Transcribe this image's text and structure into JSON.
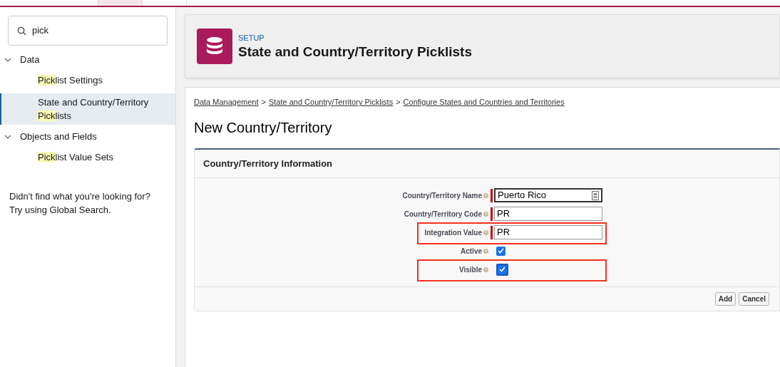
{
  "top_tabs": [
    {
      "selected": false
    },
    {
      "selected": true
    },
    {
      "selected": false
    }
  ],
  "sidebar": {
    "search": {
      "value": "pick"
    },
    "groups": [
      {
        "label": "Data",
        "expanded": true,
        "children": [
          {
            "match": "Pick",
            "rest": "list Settings",
            "selected": false
          },
          {
            "pre": "State and Country/Territory ",
            "match2": "Pick",
            "rest": "lists",
            "selected": true
          }
        ]
      },
      {
        "label": "Objects and Fields",
        "expanded": true,
        "children": [
          {
            "match": "Pick",
            "rest": "list Value Sets",
            "selected": false
          }
        ]
      }
    ],
    "hint": [
      "Didn't find what you're looking for?",
      "Try using Global Search."
    ]
  },
  "header": {
    "eyebrow": "SETUP",
    "title": "State and Country/Territory Picklists"
  },
  "breadcrumbs": [
    "Data Management",
    "State and Country/Territory Picklists",
    "Configure States and Countries and Territories"
  ],
  "breadcrumb_separator": ">",
  "page_title": "New Country/Territory",
  "section": {
    "title": "Country/Territory Information",
    "fields": [
      {
        "kind": "text",
        "label": "Country/Territory Name",
        "value": "Puerto Rico",
        "required": true,
        "lookup": true,
        "highlighted": false
      },
      {
        "kind": "text",
        "label": "Country/Territory Code",
        "value": "PR",
        "required": true,
        "lookup": false,
        "highlighted": false
      },
      {
        "kind": "text",
        "label": "Integration Value",
        "value": "PR",
        "required": true,
        "lookup": false,
        "highlighted": true
      },
      {
        "kind": "checkbox",
        "label": "Active",
        "checked": true,
        "highlighted": false
      },
      {
        "kind": "checkbox",
        "label": "Visible",
        "checked": true,
        "highlighted": true
      }
    ],
    "buttons": [
      "Add",
      "Cancel"
    ]
  }
}
